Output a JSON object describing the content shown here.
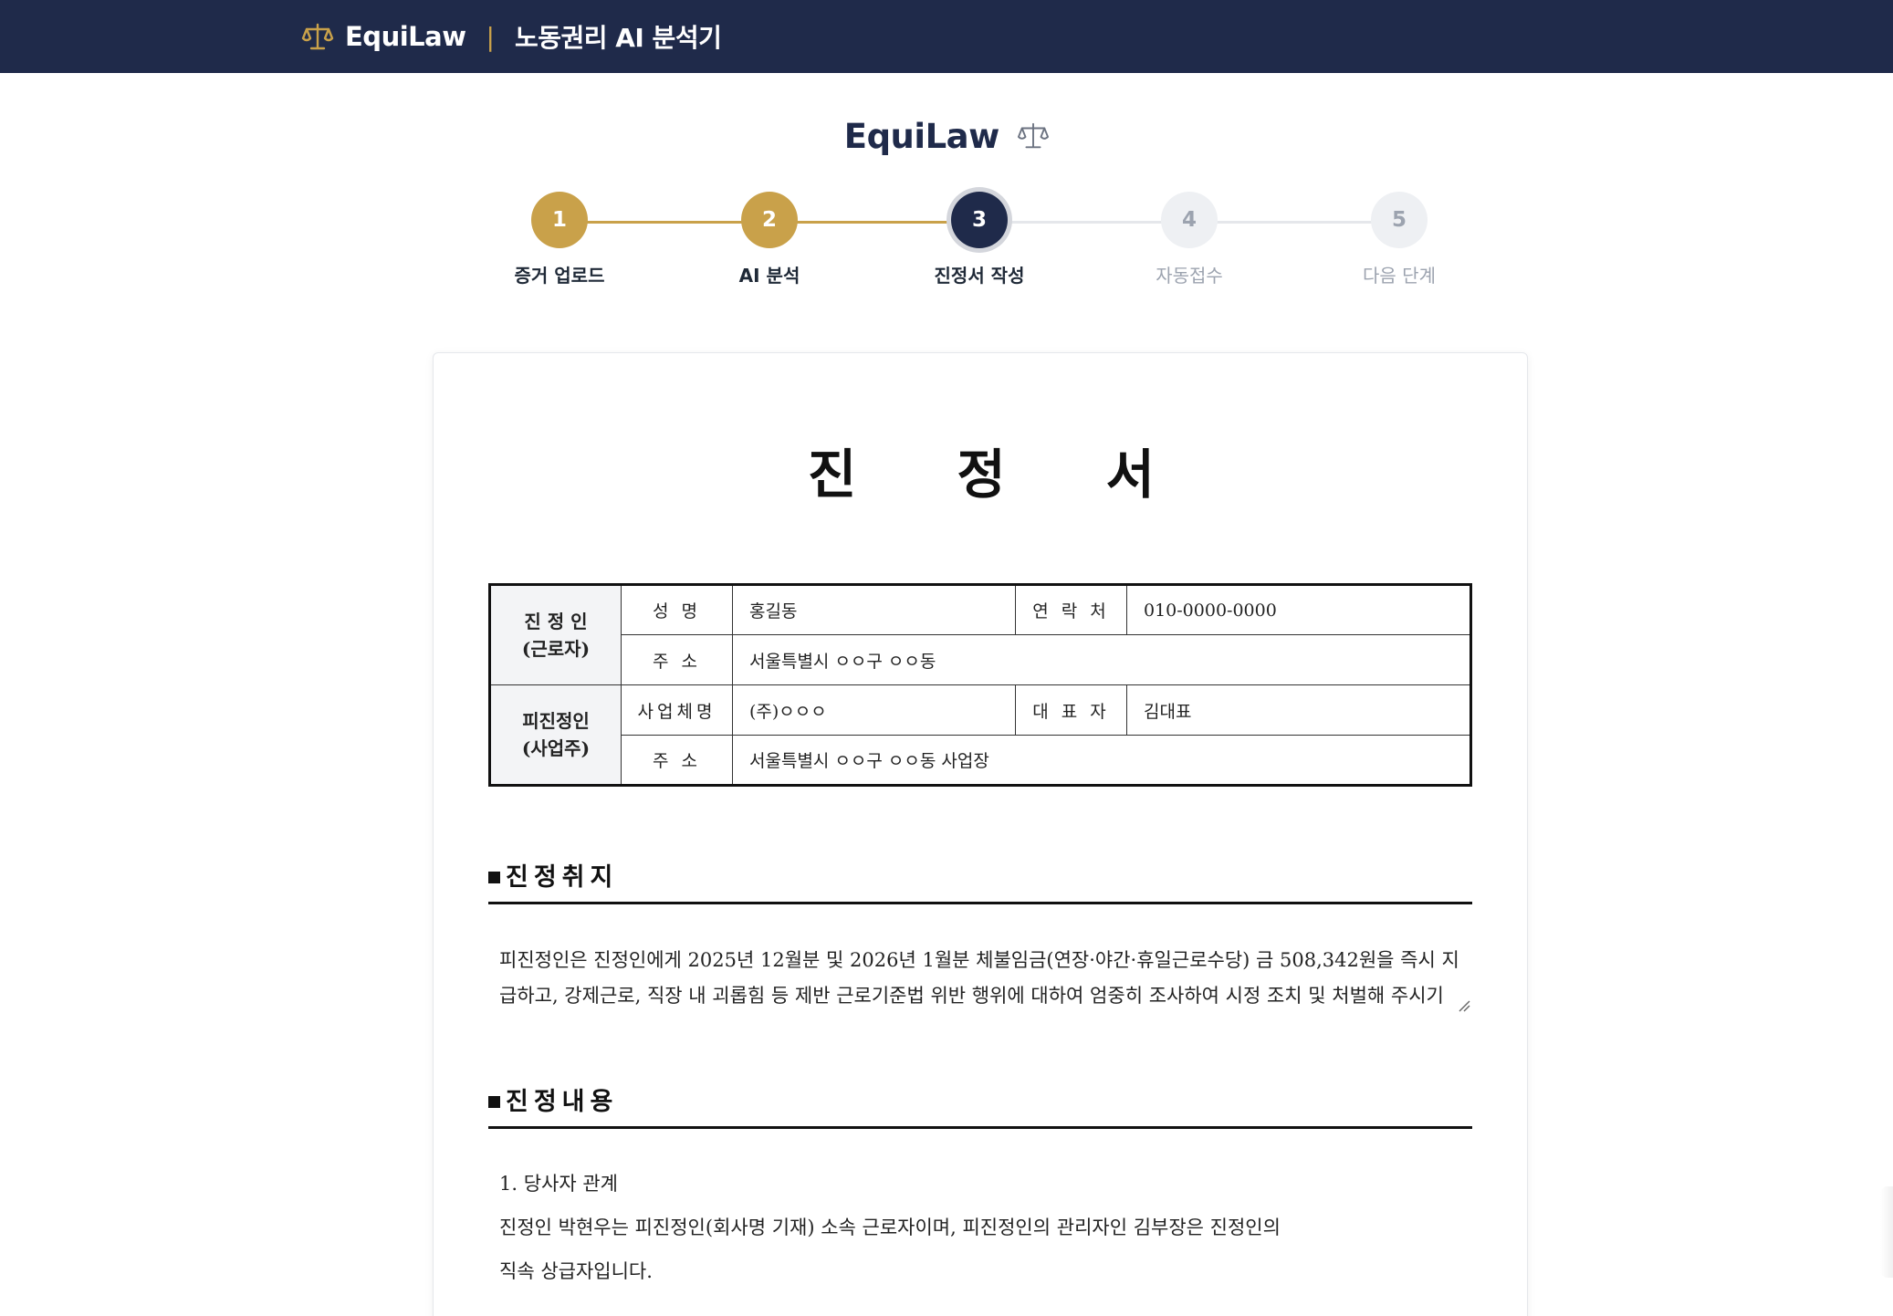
{
  "topbar": {
    "brand": "EquiLaw",
    "separator": "|",
    "subtitle": "노동권리 AI 분석기",
    "logo_icon": "scale-icon"
  },
  "page": {
    "title": "EquiLaw",
    "title_icon": "scale-icon"
  },
  "stepper": {
    "steps": [
      {
        "number": "1",
        "label": "증거 업로드",
        "state": "done"
      },
      {
        "number": "2",
        "label": "AI 분석",
        "state": "done"
      },
      {
        "number": "3",
        "label": "진정서 작성",
        "state": "active"
      },
      {
        "number": "4",
        "label": "자동접수",
        "state": "todo"
      },
      {
        "number": "5",
        "label": "다음 단계",
        "state": "todo"
      }
    ],
    "colors": {
      "done": "#c9a14a",
      "active": "#1f2a4a",
      "todo": "#eef0f3"
    }
  },
  "document": {
    "title": "진정서",
    "complainant": {
      "group_label_1": "진 정 인",
      "group_label_2": "(근로자)",
      "name_key": "성 명",
      "name_value": "홍길동",
      "contact_key": "연 락 처",
      "contact_value": "010-0000-0000",
      "address_key": "주 소",
      "address_value": "서울특별시 ㅇㅇ구 ㅇㅇ동"
    },
    "respondent": {
      "group_label_1": "피진정인",
      "group_label_2": "(사업주)",
      "business_key": "사업체명",
      "business_value": "(주)ㅇㅇㅇ",
      "rep_key": "대 표 자",
      "rep_value": "김대표",
      "address_key": "주 소",
      "address_value": "서울특별시 ㅇㅇ구 ㅇㅇ동 사업장"
    },
    "purpose_heading": "진정취지",
    "purpose_text": "피진정인은 진정인에게 2025년 12월분 및 2026년 1월분 체불임금(연장·야간·휴일근로수당) 금 508,342원을 즉시 지급하고, 강제근로, 직장 내 괴롭힘 등 제반 근로기준법 위반 행위에 대하여 엄중히 조사하여 시정 조치 및 처벌해 주시기를 요청합니다.",
    "content_heading": "진정내용",
    "content_sub1": "1. 당사자 관계",
    "content_para1_line1": "진정인 박현우는 피진정인(회사명 기재) 소속 근로자이며, 피진정인의 관리자인 김부장은 진정인의",
    "content_para1_line2": "직속 상급자입니다."
  }
}
